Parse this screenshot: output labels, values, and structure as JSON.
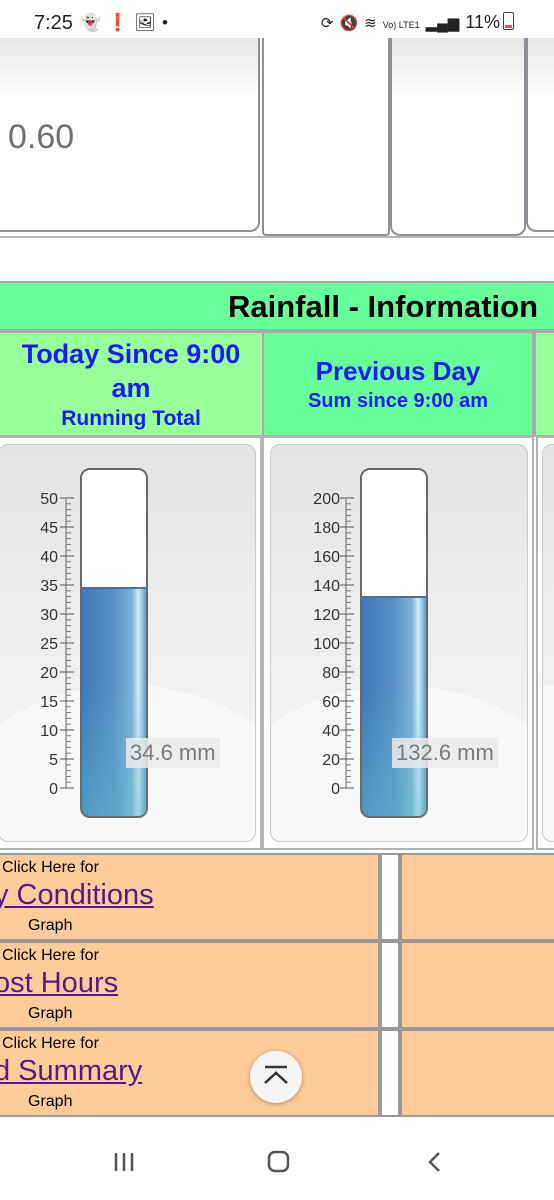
{
  "status_bar": {
    "time": "7:25",
    "left_icons": [
      "snapchat-icon",
      "alert-icon",
      "image-icon",
      "dot-icon"
    ],
    "battery": "11%",
    "net_label": "Vo) LTE1"
  },
  "top_section": {
    "partial_value": "0.60"
  },
  "rainfall": {
    "title": "Rainfall - Information",
    "col1": {
      "title": "Today Since 9:00 am",
      "subtitle": "Running Total"
    },
    "col2": {
      "title": "Previous Day",
      "subtitle": "Sum since 9:00 am"
    },
    "gauge1": {
      "max": 50,
      "ticks": [
        0,
        5,
        10,
        15,
        20,
        25,
        30,
        35,
        40,
        45,
        50
      ],
      "level": 34.6,
      "value_label": "34.6 mm"
    },
    "gauge2": {
      "max": 200,
      "ticks": [
        0,
        20,
        40,
        60,
        80,
        100,
        120,
        140,
        160,
        180,
        200
      ],
      "level": 132.6,
      "value_label": "132.6 mm"
    }
  },
  "links": [
    {
      "prefix": "Click Here for",
      "link": "y Conditions",
      "suffix": "Graph"
    },
    {
      "prefix": "Click Here for",
      "link": "ost Hours",
      "suffix": "Graph"
    },
    {
      "prefix": "Click Here for",
      "link": "d Summary",
      "suffix": "Graph"
    }
  ],
  "colors": {
    "header_green": "#66ff99",
    "col_green": "#99ff99",
    "title_blue": "#1a1aff",
    "link_orange": "#ffcc99",
    "link_purple": "#551a8b"
  }
}
